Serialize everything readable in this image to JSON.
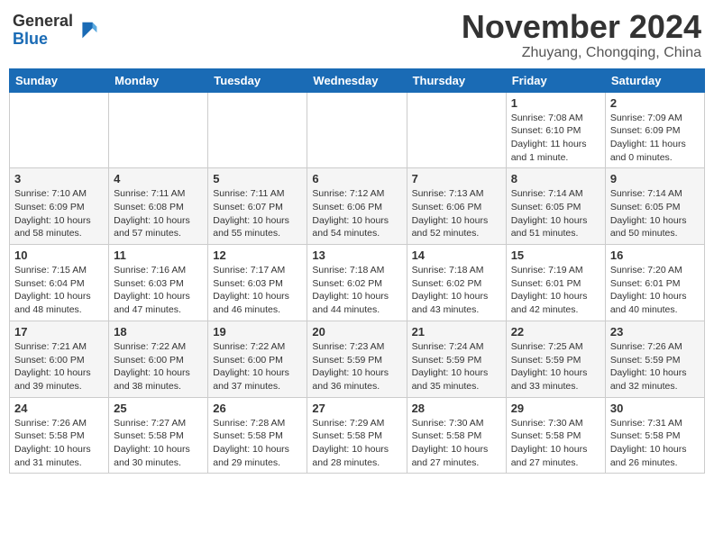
{
  "header": {
    "logo_general": "General",
    "logo_blue": "Blue",
    "month": "November 2024",
    "location": "Zhuyang, Chongqing, China"
  },
  "weekdays": [
    "Sunday",
    "Monday",
    "Tuesday",
    "Wednesday",
    "Thursday",
    "Friday",
    "Saturday"
  ],
  "weeks": [
    [
      {
        "day": "",
        "info": ""
      },
      {
        "day": "",
        "info": ""
      },
      {
        "day": "",
        "info": ""
      },
      {
        "day": "",
        "info": ""
      },
      {
        "day": "",
        "info": ""
      },
      {
        "day": "1",
        "info": "Sunrise: 7:08 AM\nSunset: 6:10 PM\nDaylight: 11 hours and 1 minute."
      },
      {
        "day": "2",
        "info": "Sunrise: 7:09 AM\nSunset: 6:09 PM\nDaylight: 11 hours and 0 minutes."
      }
    ],
    [
      {
        "day": "3",
        "info": "Sunrise: 7:10 AM\nSunset: 6:09 PM\nDaylight: 10 hours and 58 minutes."
      },
      {
        "day": "4",
        "info": "Sunrise: 7:11 AM\nSunset: 6:08 PM\nDaylight: 10 hours and 57 minutes."
      },
      {
        "day": "5",
        "info": "Sunrise: 7:11 AM\nSunset: 6:07 PM\nDaylight: 10 hours and 55 minutes."
      },
      {
        "day": "6",
        "info": "Sunrise: 7:12 AM\nSunset: 6:06 PM\nDaylight: 10 hours and 54 minutes."
      },
      {
        "day": "7",
        "info": "Sunrise: 7:13 AM\nSunset: 6:06 PM\nDaylight: 10 hours and 52 minutes."
      },
      {
        "day": "8",
        "info": "Sunrise: 7:14 AM\nSunset: 6:05 PM\nDaylight: 10 hours and 51 minutes."
      },
      {
        "day": "9",
        "info": "Sunrise: 7:14 AM\nSunset: 6:05 PM\nDaylight: 10 hours and 50 minutes."
      }
    ],
    [
      {
        "day": "10",
        "info": "Sunrise: 7:15 AM\nSunset: 6:04 PM\nDaylight: 10 hours and 48 minutes."
      },
      {
        "day": "11",
        "info": "Sunrise: 7:16 AM\nSunset: 6:03 PM\nDaylight: 10 hours and 47 minutes."
      },
      {
        "day": "12",
        "info": "Sunrise: 7:17 AM\nSunset: 6:03 PM\nDaylight: 10 hours and 46 minutes."
      },
      {
        "day": "13",
        "info": "Sunrise: 7:18 AM\nSunset: 6:02 PM\nDaylight: 10 hours and 44 minutes."
      },
      {
        "day": "14",
        "info": "Sunrise: 7:18 AM\nSunset: 6:02 PM\nDaylight: 10 hours and 43 minutes."
      },
      {
        "day": "15",
        "info": "Sunrise: 7:19 AM\nSunset: 6:01 PM\nDaylight: 10 hours and 42 minutes."
      },
      {
        "day": "16",
        "info": "Sunrise: 7:20 AM\nSunset: 6:01 PM\nDaylight: 10 hours and 40 minutes."
      }
    ],
    [
      {
        "day": "17",
        "info": "Sunrise: 7:21 AM\nSunset: 6:00 PM\nDaylight: 10 hours and 39 minutes."
      },
      {
        "day": "18",
        "info": "Sunrise: 7:22 AM\nSunset: 6:00 PM\nDaylight: 10 hours and 38 minutes."
      },
      {
        "day": "19",
        "info": "Sunrise: 7:22 AM\nSunset: 6:00 PM\nDaylight: 10 hours and 37 minutes."
      },
      {
        "day": "20",
        "info": "Sunrise: 7:23 AM\nSunset: 5:59 PM\nDaylight: 10 hours and 36 minutes."
      },
      {
        "day": "21",
        "info": "Sunrise: 7:24 AM\nSunset: 5:59 PM\nDaylight: 10 hours and 35 minutes."
      },
      {
        "day": "22",
        "info": "Sunrise: 7:25 AM\nSunset: 5:59 PM\nDaylight: 10 hours and 33 minutes."
      },
      {
        "day": "23",
        "info": "Sunrise: 7:26 AM\nSunset: 5:59 PM\nDaylight: 10 hours and 32 minutes."
      }
    ],
    [
      {
        "day": "24",
        "info": "Sunrise: 7:26 AM\nSunset: 5:58 PM\nDaylight: 10 hours and 31 minutes."
      },
      {
        "day": "25",
        "info": "Sunrise: 7:27 AM\nSunset: 5:58 PM\nDaylight: 10 hours and 30 minutes."
      },
      {
        "day": "26",
        "info": "Sunrise: 7:28 AM\nSunset: 5:58 PM\nDaylight: 10 hours and 29 minutes."
      },
      {
        "day": "27",
        "info": "Sunrise: 7:29 AM\nSunset: 5:58 PM\nDaylight: 10 hours and 28 minutes."
      },
      {
        "day": "28",
        "info": "Sunrise: 7:30 AM\nSunset: 5:58 PM\nDaylight: 10 hours and 27 minutes."
      },
      {
        "day": "29",
        "info": "Sunrise: 7:30 AM\nSunset: 5:58 PM\nDaylight: 10 hours and 27 minutes."
      },
      {
        "day": "30",
        "info": "Sunrise: 7:31 AM\nSunset: 5:58 PM\nDaylight: 10 hours and 26 minutes."
      }
    ]
  ]
}
